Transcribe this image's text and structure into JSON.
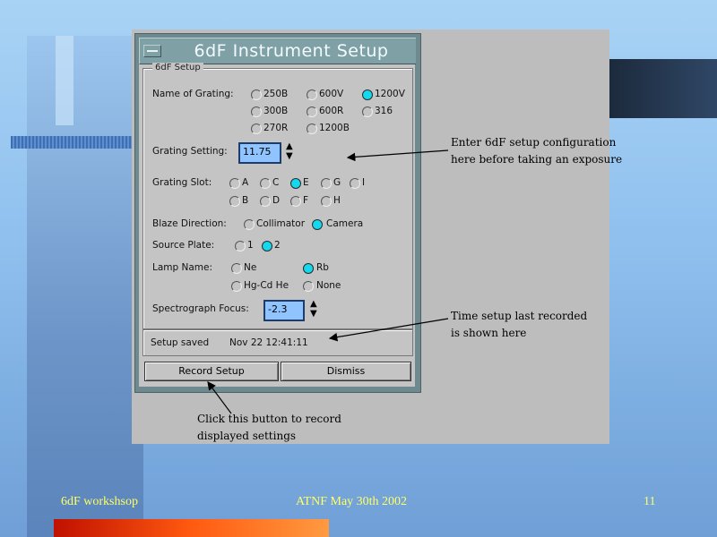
{
  "window": {
    "title": "6dF Instrument Setup"
  },
  "frame_label": "6dF Setup",
  "grating": {
    "label": "Name of Grating:",
    "options": [
      "250B",
      "600V",
      "1200V",
      "300B",
      "600R",
      "316",
      "270R",
      "1200B"
    ],
    "selected": "1200V"
  },
  "grating_setting": {
    "label": "Grating Setting:",
    "value": "11.75"
  },
  "grating_slot": {
    "label": "Grating Slot:",
    "options": [
      "A",
      "C",
      "E",
      "G",
      "I",
      "B",
      "D",
      "F",
      "H"
    ],
    "selected": "E"
  },
  "blaze": {
    "label": "Blaze Direction:",
    "options": [
      "Collimator",
      "Camera"
    ],
    "selected": "Camera"
  },
  "source_plate": {
    "label": "Source Plate:",
    "options": [
      "1",
      "2"
    ],
    "selected": "2"
  },
  "lamp": {
    "label": "Lamp Name:",
    "options": [
      "Ne",
      "Rb",
      "Hg-Cd He",
      "None"
    ],
    "selected": "Rb"
  },
  "focus": {
    "label": "Spectrograph Focus:",
    "value": "-2.3"
  },
  "status": {
    "label": "Setup saved",
    "time": "Nov 22 12:41:11"
  },
  "buttons": {
    "record": "Record Setup",
    "dismiss": "Dismiss"
  },
  "annotations": {
    "config_1": "Enter 6dF setup configuration",
    "config_2": "here before taking an exposure",
    "time_1": "Time setup last recorded",
    "time_2": "is shown here",
    "click_1": "Click this button to record",
    "click_2": "displayed settings"
  },
  "footer": {
    "left": "6dF workshsop",
    "center": "ATNF May 30th 2002",
    "page": "11"
  },
  "colors": {
    "selected_radio": "#14d8ee",
    "entry_bg": "#8fc4ff",
    "footer_text": "#ffff66"
  }
}
